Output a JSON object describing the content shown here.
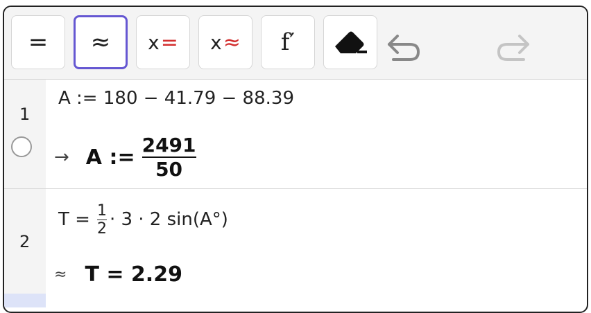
{
  "toolbar": {
    "exact_symbol": "=",
    "approx_symbol": "≈",
    "solve_x_label": "x",
    "solve_x_eq": "=",
    "nsolve_x_label": "x",
    "nsolve_x_approx": "≈",
    "derivative_label": "f′",
    "active_tool": "approx"
  },
  "rows": [
    {
      "number": "1",
      "input": "A := 180 − 41.79 − 88.39",
      "output_arrow": "→",
      "output_lhs": "A :=",
      "output_num": "2491",
      "output_den": "50"
    },
    {
      "number": "2",
      "input_lhs": "T =",
      "input_frac_num": "1",
      "input_frac_den": "2",
      "input_rest": "· 3 · 2 sin(A°)",
      "output_marker": "≈",
      "output": "T = 2.29"
    }
  ],
  "colors": {
    "accent": "#6557d2",
    "solve_red": "#d32f2f",
    "gutter": "#f4f4f4",
    "border": "#d6d6d6"
  },
  "icons": [
    "eraser-icon",
    "undo-icon",
    "redo-icon",
    "toggle-circle-icon"
  ]
}
